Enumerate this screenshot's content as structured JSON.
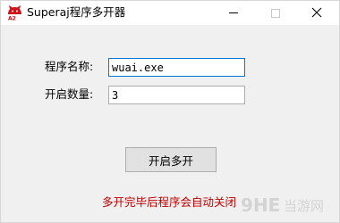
{
  "window": {
    "title": "Superaj程序多开器",
    "icon": "red-cat-logo-icon",
    "controls": {
      "minimize": "minimize-icon",
      "maximize": "maximize-icon",
      "close": "close-icon"
    }
  },
  "form": {
    "program_name_label": "程序名称:",
    "program_name_value": "wuai.exe",
    "open_count_label": "开启数量:",
    "open_count_value": "3",
    "launch_button_label": "开启多开"
  },
  "notice": {
    "text": "多开完毕后程序会自动关闭"
  },
  "watermark": {
    "brand": "9HE 当游网"
  },
  "colors": {
    "window_bg": "#f0f0f0",
    "titlebar_bg": "#ffffff",
    "notice_text": "#c00000",
    "focus_border": "#0078d7",
    "button_bg": "#e1e1e1"
  }
}
